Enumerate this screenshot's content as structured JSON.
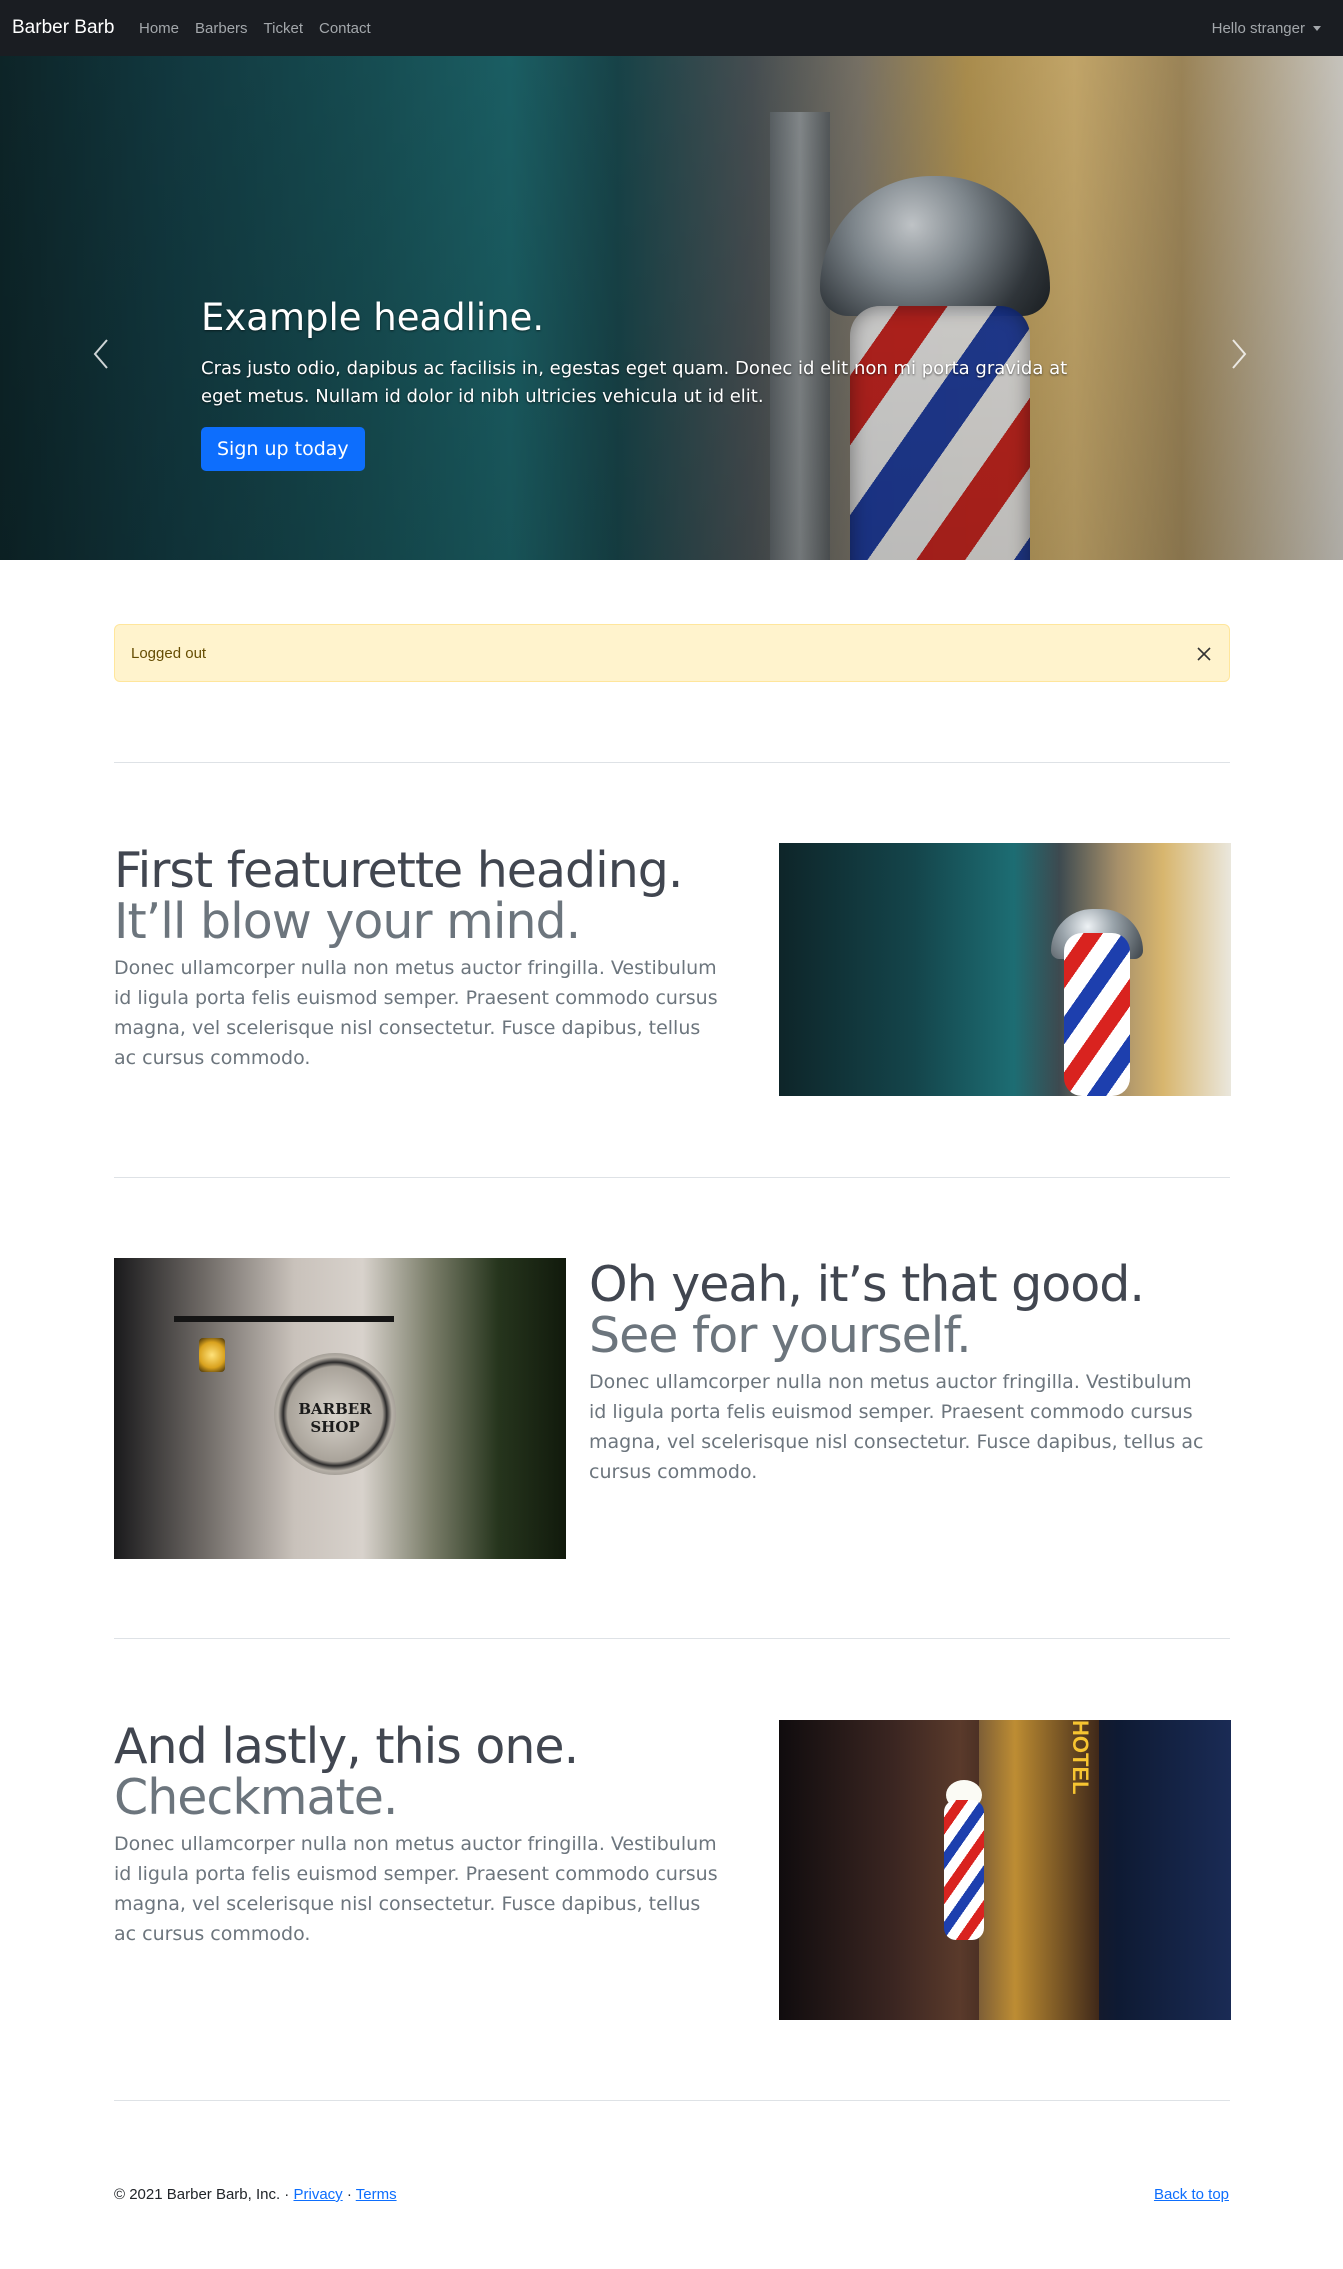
{
  "nav": {
    "brand": "Barber Barb",
    "links": [
      "Home",
      "Barbers",
      "Ticket",
      "Contact"
    ],
    "user": "Hello stranger"
  },
  "hero": {
    "title": "Example headline.",
    "text": "Cras justo odio, dapibus ac facilisis in, egestas eget quam. Donec id elit non mi porta gravida at eget metus. Nullam id dolor id nibh ultricies vehicula ut id elit.",
    "button": "Sign up today",
    "slide_count": 3,
    "active_slide": 1
  },
  "alert": {
    "text": "Logged out"
  },
  "featurettes": [
    {
      "heading": "First featurette heading.",
      "heading_muted": "It’ll blow your mind.",
      "text": "Donec ullamcorper nulla non metus auctor fringilla. Vestibulum id ligula porta felis euismod semper. Praesent commodo cursus magna, vel scelerisque nisl consectetur. Fusce dapibus, tellus ac cursus commodo."
    },
    {
      "heading": "Oh yeah, it’s that good.",
      "heading_muted": "See for yourself.",
      "text": "Donec ullamcorper nulla non metus auctor fringilla. Vestibulum id ligula porta felis euismod semper. Praesent commodo cursus magna, vel scelerisque nisl consectetur. Fusce dapibus, tellus ac cursus commodo.",
      "image_sign": "BARBER SHOP"
    },
    {
      "heading": "And lastly, this one.",
      "heading_muted": "Checkmate.",
      "text": "Donec ullamcorper nulla non metus auctor fringilla. Vestibulum id ligula porta felis euismod semper. Praesent commodo cursus magna, vel scelerisque nisl consectetur. Fusce dapibus, tellus ac cursus commodo.",
      "image_sign": "HOTEL"
    }
  ],
  "footer": {
    "copyright": "© 2021 Barber Barb, Inc. · ",
    "privacy": "Privacy",
    "separator": " · ",
    "terms": "Terms",
    "back_to_top": "Back to top"
  },
  "colors": {
    "navbar": "#1a1d22",
    "primary": "#0d6efd",
    "alert_bg": "#fff3cd",
    "heading": "#414650",
    "muted": "#6c757d"
  }
}
